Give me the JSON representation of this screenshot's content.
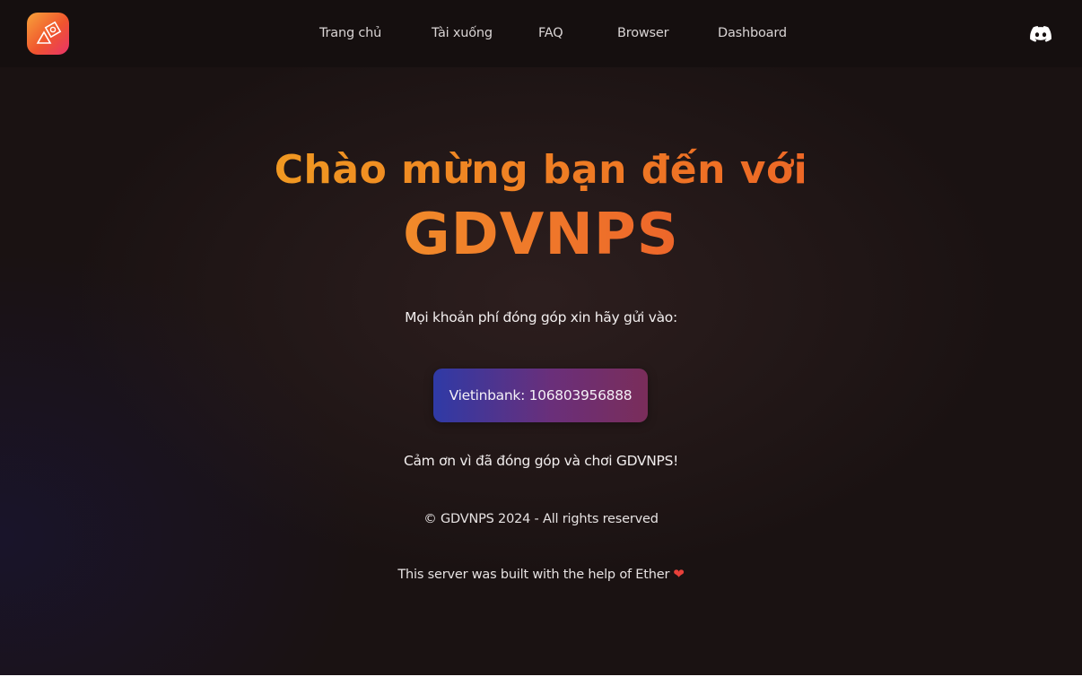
{
  "nav": {
    "links": [
      {
        "label": "Trang chủ"
      },
      {
        "label": "Tài xuống"
      },
      {
        "label": "FAQ"
      },
      {
        "label": "Browser"
      },
      {
        "label": "Dashboard"
      }
    ],
    "logo_icon": "app-logo-icon",
    "discord_icon": "discord-icon"
  },
  "hero": {
    "line1": "Chào mừng bạn đến với",
    "line2": "GDVNPS"
  },
  "donation": {
    "intro": "Mọi khoản phí đóng góp xin hãy gửi vào:",
    "button_label": "Vietinbank: 106803956888",
    "thanks": "Cảm ơn vì đã đóng góp và chơi GDVNPS!"
  },
  "footer": {
    "copyright": "© GDVNPS 2024 - All rights reserved",
    "credit": "This server was built with the help of Ether",
    "heart": "❤"
  },
  "colors": {
    "background": "#1a1212",
    "navbar": "#150f0f",
    "title_gradient_start": "#f2b320",
    "title_gradient_end": "#ea5028",
    "button_gradient_start": "#2f3aa6",
    "button_gradient_end": "#7a2d5a"
  }
}
